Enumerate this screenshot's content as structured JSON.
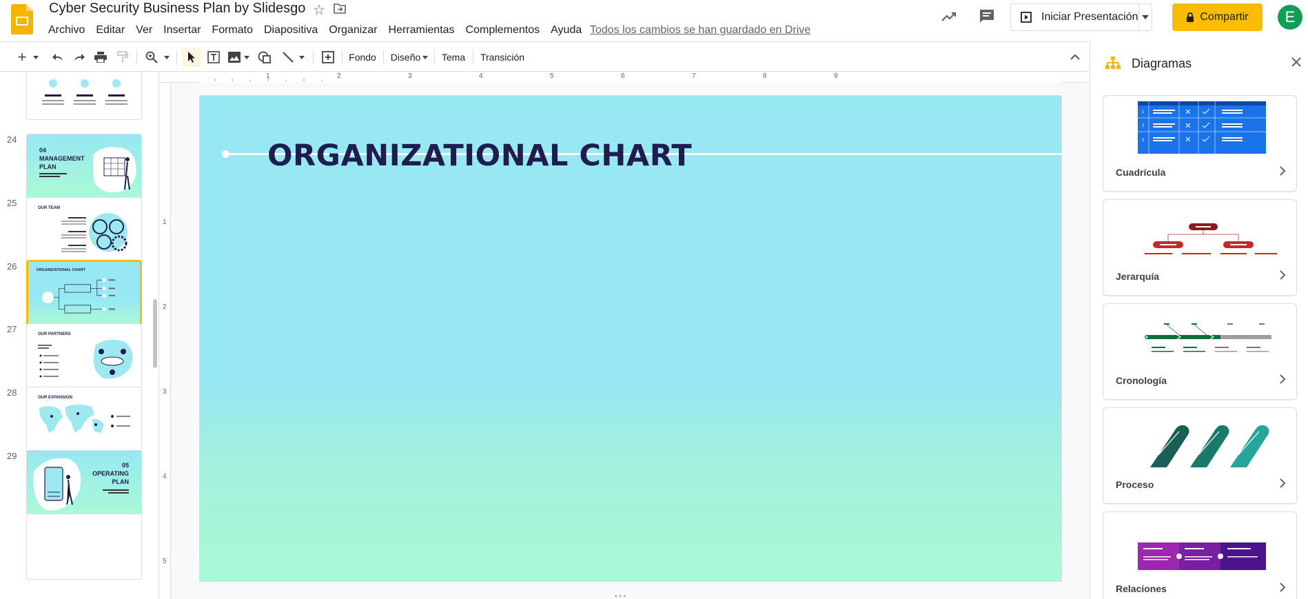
{
  "app": {
    "doc_title": "Cyber Security Business Plan by Slidesgo",
    "menu": [
      "Archivo",
      "Editar",
      "Ver",
      "Insertar",
      "Formato",
      "Diapositiva",
      "Organizar",
      "Herramientas",
      "Complementos",
      "Ayuda"
    ],
    "saved_status": "Todos los cambios se han guardado en Drive",
    "present_label": "Iniciar Presentación",
    "share_label": "Compartir",
    "avatar_initial": "E",
    "accent_color": "#fbbc04",
    "avatar_color": "#0f9d58"
  },
  "toolbar": {
    "background_label": "Fondo",
    "design_label": "Diseño",
    "theme_label": "Tema",
    "transition_label": "Transición"
  },
  "filmstrip": {
    "slides": [
      {
        "number": "24",
        "title": "04 MANAGEMENT PLAN"
      },
      {
        "number": "25",
        "title": "OUR TEAM"
      },
      {
        "number": "26",
        "title": "ORGANIZATIONAL CHART",
        "selected": true
      },
      {
        "number": "27",
        "title": "OUR PARTNERS"
      },
      {
        "number": "28",
        "title": "OUR EXPANSION"
      },
      {
        "number": "29",
        "title": "05 OPERATING PLAN"
      }
    ]
  },
  "rulers": {
    "horizontal": [
      "1",
      "2",
      "3",
      "4",
      "5",
      "6",
      "7",
      "8",
      "9"
    ],
    "vertical": [
      "1",
      "2",
      "3",
      "4",
      "5"
    ]
  },
  "slide": {
    "title": "ORGANIZATIONAL CHART",
    "title_color": "#1e1d4d"
  },
  "panel": {
    "title": "Diagramas",
    "cards": [
      {
        "label": "Cuadrícula"
      },
      {
        "label": "Jerarquía"
      },
      {
        "label": "Cronología"
      },
      {
        "label": "Proceso"
      },
      {
        "label": "Relaciones"
      }
    ]
  }
}
